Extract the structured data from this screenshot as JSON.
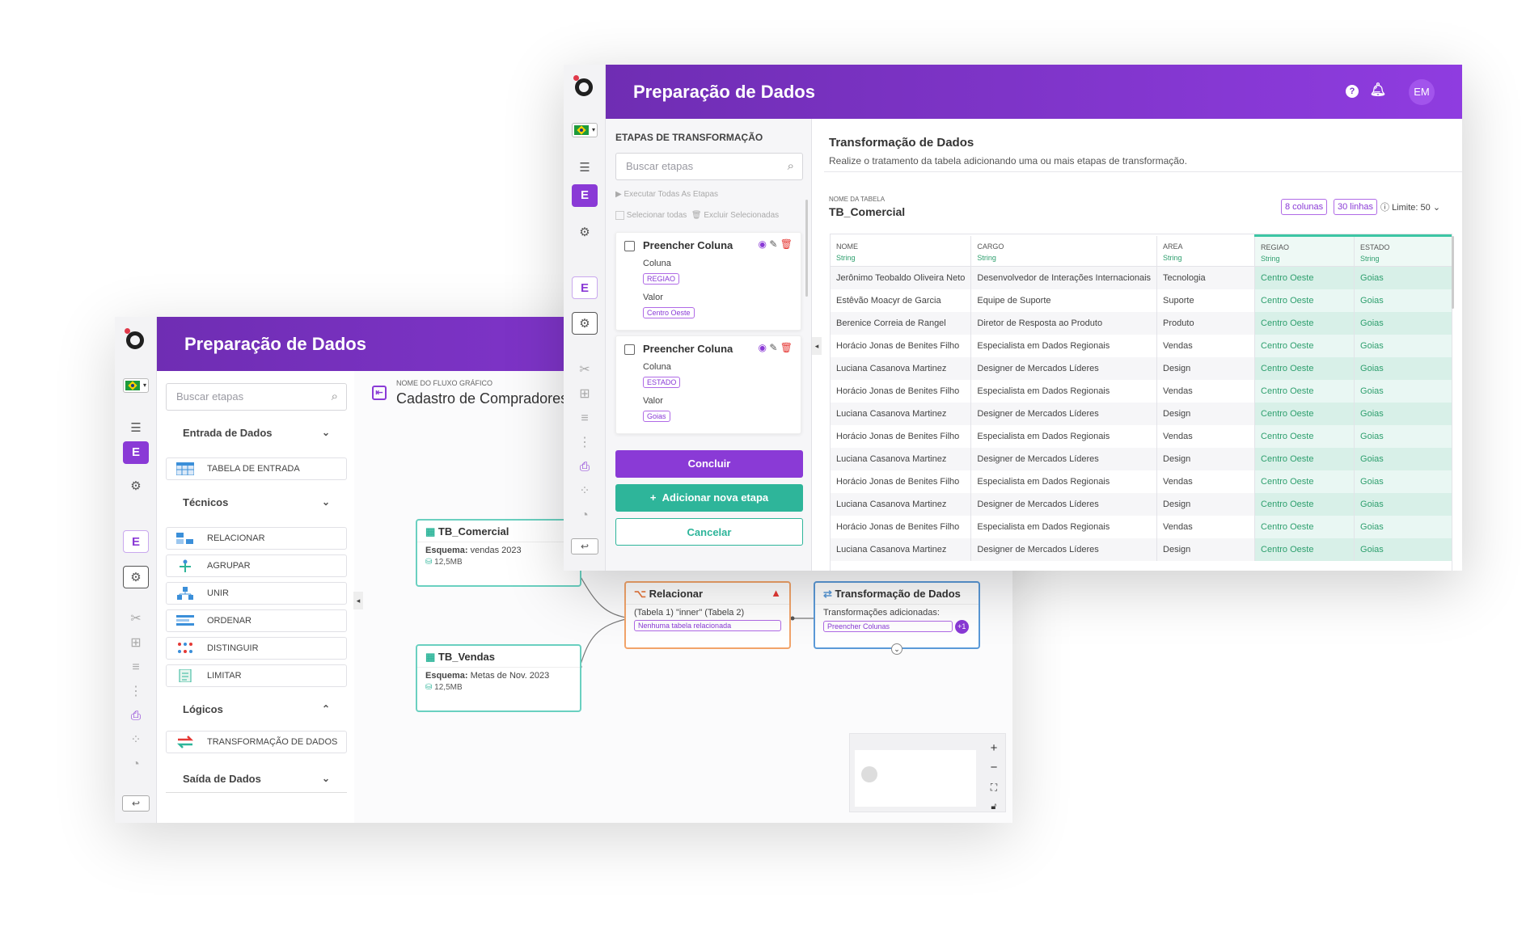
{
  "window_back": {
    "header_title": "Preparação de Dados",
    "search_placeholder": "Buscar etapas",
    "sections": {
      "input": "Entrada de Dados",
      "technical": "Técnicos",
      "logical": "Lógicos",
      "output": "Saída de Dados"
    },
    "input_items": [
      "TABELA DE ENTRADA"
    ],
    "technical_items": [
      "RELACIONAR",
      "AGRUPAR",
      "UNIR",
      "ORDENAR",
      "DISTINGUIR",
      "LIMITAR"
    ],
    "logical_items": [
      "TRANSFORMAÇÃO DE DADOS"
    ],
    "flow_label": "NOME DO FLUXO GRÁFICO",
    "flow_name": "Cadastro de Compradores",
    "nodes": {
      "tb_comercial": {
        "title": "TB_Comercial",
        "schema_label": "Esquema:",
        "schema": "vendas 2023",
        "size": "12,5MB"
      },
      "tb_vendas": {
        "title": "TB_Vendas",
        "schema_label": "Esquema:",
        "schema": "Metas de Nov. 2023",
        "size": "12,5MB"
      },
      "relacionar": {
        "title": "Relacionar",
        "desc": "(Tabela 1) \"inner\" (Tabela 2)",
        "tag": "Nenhuma tabela relacionada"
      },
      "transformacao": {
        "title": "Transformação de Dados",
        "desc": "Transformações adicionadas:",
        "tag": "Preencher Colunas",
        "badge": "+1"
      }
    }
  },
  "window_front": {
    "header_title": "Preparação de Dados",
    "avatar": "EM",
    "steps_title": "ETAPAS DE TRANSFORMAÇÃO",
    "search_placeholder": "Buscar etapas",
    "run_all": "Executar Todas As Etapas",
    "select_all": "Selecionar todas",
    "delete_selected": "Excluir Selecionadas",
    "steps": [
      {
        "title": "Preencher Coluna",
        "col_label": "Coluna",
        "col": "REGIAO",
        "val_label": "Valor",
        "val": "Centro Oeste"
      },
      {
        "title": "Preencher Coluna",
        "col_label": "Coluna",
        "col": "ESTADO",
        "val_label": "Valor",
        "val": "Goias"
      }
    ],
    "btn_conclude": "Concluir",
    "btn_add": "Adicionar nova etapa",
    "btn_cancel": "Cancelar",
    "main_title": "Transformação de Dados",
    "main_desc": "Realize o tratamento da tabela adicionando uma ou mais etapas de transformação.",
    "table_label": "NOME DA TABELA",
    "table_name": "TB_Comercial",
    "cols_pill": "8 colunas",
    "rows_pill": "30 linhas",
    "limit": "Limite: 50",
    "columns": [
      {
        "name": "NOME",
        "type": "String"
      },
      {
        "name": "CARGO",
        "type": "String"
      },
      {
        "name": "AREA",
        "type": "String"
      },
      {
        "name": "REGIAO",
        "type": "String"
      },
      {
        "name": "ESTADO",
        "type": "String"
      }
    ],
    "rows": [
      [
        "Jerônimo Teobaldo Oliveira Neto",
        "Desenvolvedor de Interações Internacionais",
        "Tecnologia",
        "Centro Oeste",
        "Goias"
      ],
      [
        "Estêvão Moacyr de Garcia",
        "Equipe de Suporte",
        "Suporte",
        "Centro Oeste",
        "Goias"
      ],
      [
        "Berenice Correia de Rangel",
        "Diretor de Resposta ao Produto",
        "Produto",
        "Centro Oeste",
        "Goias"
      ],
      [
        "Horácio Jonas de Benites Filho",
        "Especialista em Dados Regionais",
        "Vendas",
        "Centro Oeste",
        "Goias"
      ],
      [
        "Luciana Casanova Martinez",
        "Designer de Mercados Líderes",
        "Design",
        "Centro Oeste",
        "Goias"
      ],
      [
        "Horácio Jonas de Benites Filho",
        "Especialista em Dados Regionais",
        "Vendas",
        "Centro Oeste",
        "Goias"
      ],
      [
        "Luciana Casanova Martinez",
        "Designer de Mercados Líderes",
        "Design",
        "Centro Oeste",
        "Goias"
      ],
      [
        "Horácio Jonas de Benites Filho",
        "Especialista em Dados Regionais",
        "Vendas",
        "Centro Oeste",
        "Goias"
      ],
      [
        "Luciana Casanova Martinez",
        "Designer de Mercados Líderes",
        "Design",
        "Centro Oeste",
        "Goias"
      ],
      [
        "Horácio Jonas de Benites Filho",
        "Especialista em Dados Regionais",
        "Vendas",
        "Centro Oeste",
        "Goias"
      ],
      [
        "Luciana Casanova Martinez",
        "Designer de Mercados Líderes",
        "Design",
        "Centro Oeste",
        "Goias"
      ],
      [
        "Horácio Jonas de Benites Filho",
        "Especialista em Dados Regionais",
        "Vendas",
        "Centro Oeste",
        "Goias"
      ],
      [
        "Luciana Casanova Martinez",
        "Designer de Mercados Líderes",
        "Design",
        "Centro Oeste",
        "Goias"
      ]
    ]
  },
  "icons": {
    "search": "search-icon",
    "chevron": "chevron-down-icon",
    "help": "help-icon",
    "notifications": "bell-icon",
    "eye": "eye-icon",
    "edit": "pencil-icon",
    "delete": "trash-icon"
  },
  "colors": {
    "primary": "#8a3ad6",
    "teal": "#2eb59a",
    "warning": "#e53935"
  }
}
